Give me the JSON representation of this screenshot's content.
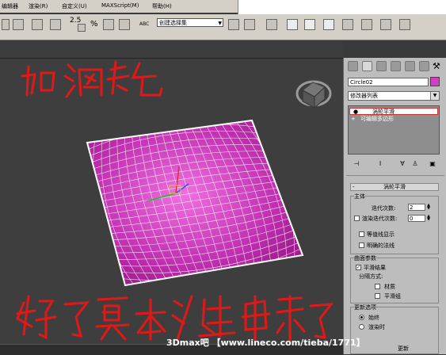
{
  "menubar": {
    "items": [
      "编辑器",
      "渲染(R)",
      "自定义(U)",
      "MAXScript(M)",
      "帮助(H)"
    ]
  },
  "toolbar": {
    "selection_set": "创建选择集",
    "angle_snap": "2.5",
    "percent_label": "%",
    "sel_prefix": "ABC"
  },
  "viewport": {
    "handwriting_top": "加涡轮",
    "handwriting_bottom": "好了基本形出来了",
    "mesh_color": "#d040c0",
    "wire_color": "#ffffff"
  },
  "command_panel": {
    "object_name": "Circle02",
    "object_color": "#d33fc4",
    "modifier_list": "修改器列表",
    "stack": [
      {
        "label": "涡轮平滑",
        "selected": true
      },
      {
        "label": "可编辑多边形",
        "selected": false
      }
    ],
    "rollout_title": "涡轮平滑",
    "main_group": "主体",
    "iterations_label": "迭代次数:",
    "iterations_value": "2",
    "render_iters_label": "渲染迭代次数:",
    "render_iters_value": "0",
    "isoline_label": "等值线显示",
    "explicit_normals_label": "明确的法线",
    "surface_group": "曲面参数",
    "smooth_result_label": "平滑结果",
    "separate_label": "分隔方式:",
    "materials_label": "材质",
    "smooth_groups_label": "平滑组",
    "update_group": "更新选项",
    "always_label": "始终",
    "when_rendering_label": "渲染时",
    "update_button": "更新"
  },
  "watermark": "3Dmax吧 【www.lineco.com/tieba/1771】"
}
